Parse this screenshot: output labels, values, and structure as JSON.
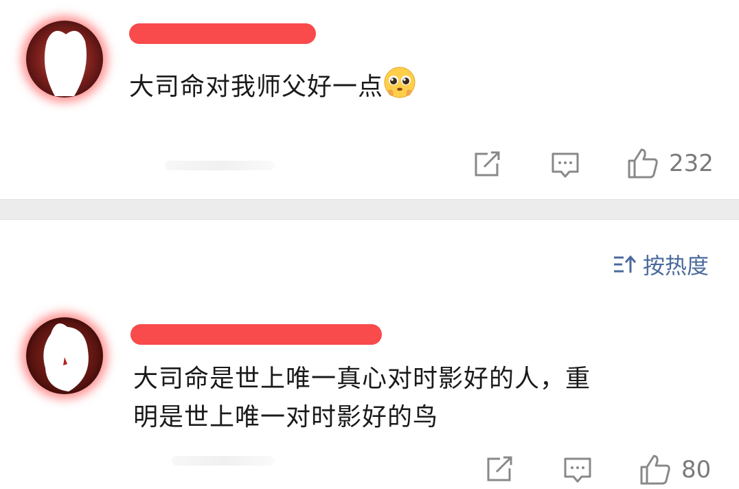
{
  "comments": [
    {
      "text": "大司命对我师父好一点",
      "emoji": "pleading-face-emoji",
      "name_hint": "",
      "like_count": "232"
    },
    {
      "text_line1": "大司命是世上唯一真心对时影好的人，重",
      "text_line2": "明是世上唯一对时影好的鸟",
      "like_count": "80"
    }
  ],
  "sort": {
    "label": "按热度",
    "icon": "sort-icon"
  },
  "icons": {
    "share": "share-icon",
    "reply": "reply-comment-icon",
    "like": "thumbs-up-icon"
  },
  "colors": {
    "redaction": "#f94a4c",
    "sort_accent": "#4a6a9c",
    "action_gray": "#888888",
    "divider": "#ececec"
  }
}
